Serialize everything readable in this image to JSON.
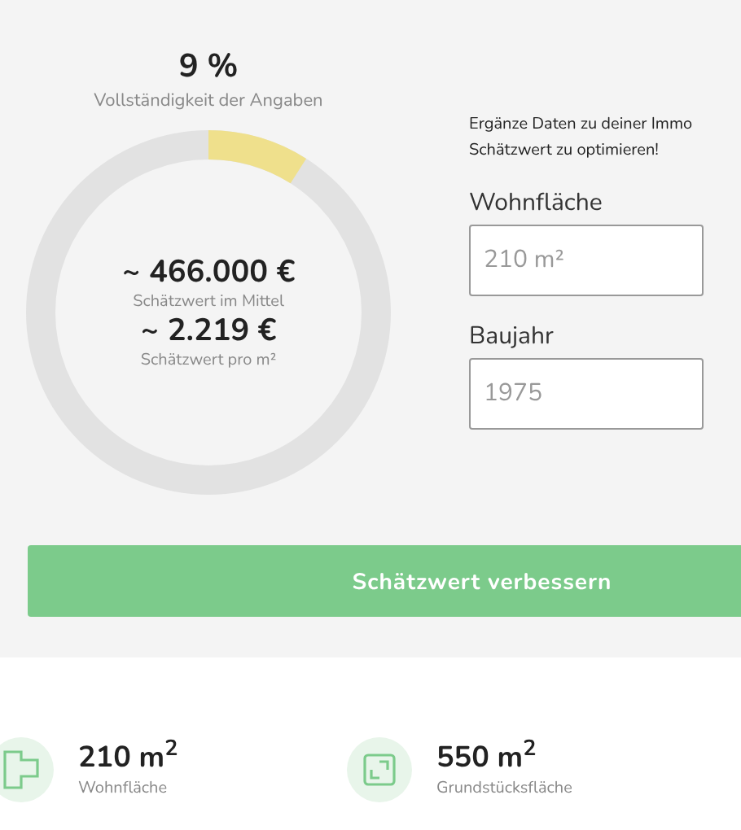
{
  "completeness": {
    "value": "9 %",
    "label": "Vollständigkeit der Angaben",
    "level": 0.09
  },
  "estimate": {
    "total": "~ 466.000 €",
    "total_label": "Schätzwert im Mittel",
    "per_sqm": "~ 2.219 €",
    "per_sqm_label": "Schätzwert pro m²"
  },
  "intro_lines": [
    "Ergänze Daten zu deiner Immo",
    "Schätzwert zu optimieren!"
  ],
  "fields": [
    {
      "label": "Wohnfläche",
      "placeholder": "210 m²"
    },
    {
      "label": "Baujahr",
      "placeholder": "1975"
    }
  ],
  "button": "Schätzwert verbessern",
  "stats": [
    {
      "kind": "floorplan",
      "value": "210 m$^{2}$",
      "label": "Wohnfläche"
    },
    {
      "kind": "plot",
      "value": "550 m$^{2}$",
      "label": "Grundstücksfläche"
    }
  ]
}
